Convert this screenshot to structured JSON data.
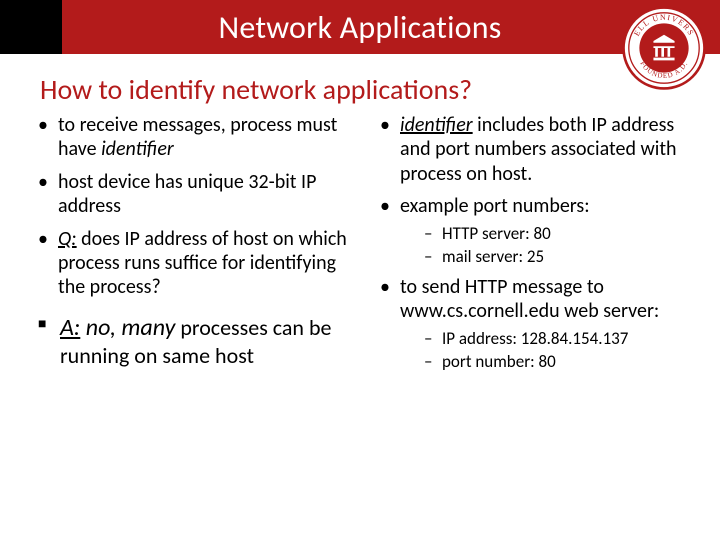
{
  "title": "Network Applications",
  "subtitle": "How to identify network applications?",
  "logo": {
    "name": "cornell-seal",
    "top_text": "ELL UNIV",
    "bottom_text": "FOUNDED"
  },
  "left": {
    "b1_a": "to receive messages, process  must have ",
    "b1_b": "identifier",
    "b2": "host device has unique 32-bit IP address",
    "b3_q": "Q:",
    "b3_rest": " does  IP address of host on which process runs suffice for identifying the process?",
    "ans_label": "A:",
    "ans_a": " no, ",
    "ans_b": "many",
    "ans_c": " processes can be running on same host"
  },
  "right": {
    "b1_a": "identifier",
    "b1_b": " includes both IP address and port numbers associated with process on host.",
    "b2": "example port numbers:",
    "s1": "HTTP server: 80",
    "s2": "mail server: 25",
    "b3": "to send HTTP message to www.cs.cornell.edu web server:",
    "s3": "IP address: 128.84.154.137",
    "s4": "port number: 80"
  }
}
